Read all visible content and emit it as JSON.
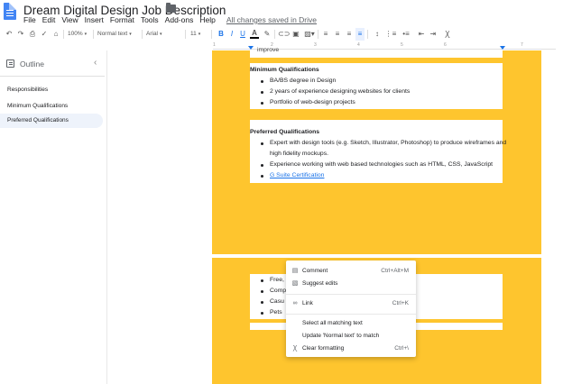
{
  "app": {
    "title": "Dream Digital Design Job Description",
    "menu": [
      "File",
      "Edit",
      "View",
      "Insert",
      "Format",
      "Tools",
      "Add-ons",
      "Help"
    ],
    "saved_status": "All changes saved in Drive"
  },
  "toolbar": {
    "zoom": "100%",
    "style": "Normal text",
    "font": "Arial",
    "size": "11",
    "bold": "B",
    "italic": "I",
    "underline": "U",
    "text_color": "A"
  },
  "ruler": {
    "numbers": [
      "1",
      "2",
      "3",
      "4",
      "5",
      "6",
      "7"
    ]
  },
  "outline": {
    "title": "Outline",
    "items": [
      {
        "label": "Responsibilities"
      },
      {
        "label": "Minimum Qualifications"
      },
      {
        "label": "Preferred Qualifications"
      }
    ]
  },
  "document": {
    "page_color": "#fec52e",
    "cutoff_text": "improve",
    "min_heading": "Minimum Qualifications",
    "min_items": [
      "BA/BS degree in Design",
      "2 years of experience designing websites for clients",
      "Portfolio of web-design projects"
    ],
    "pref_heading": "Preferred Qualifications",
    "pref_items": [
      "Expert with design tools (e.g. Sketch, Illustrator, Photoshop) to produce wireframes and",
      "high fidelity mockups.",
      "Experience working with web based technologies such as HTML, CSS, JavaScript"
    ],
    "pref_link": "G Suite Certification",
    "page2_items": [
      "Free,",
      "Comp",
      "Casu",
      "Pets"
    ]
  },
  "context_menu": {
    "items": [
      {
        "icon": "comment-icon",
        "label": "Comment",
        "shortcut": "Ctrl+Alt+M"
      },
      {
        "icon": "suggest-edits-icon",
        "label": "Suggest edits",
        "shortcut": ""
      },
      {
        "icon": "link-icon",
        "label": "Link",
        "shortcut": "Ctrl+K"
      },
      {
        "icon": "",
        "label": "Select all matching text",
        "shortcut": ""
      },
      {
        "icon": "",
        "label": "Update 'Normal text' to match",
        "shortcut": ""
      },
      {
        "icon": "clear-formatting-icon",
        "label": "Clear formatting",
        "shortcut": "Ctrl+\\"
      }
    ]
  }
}
